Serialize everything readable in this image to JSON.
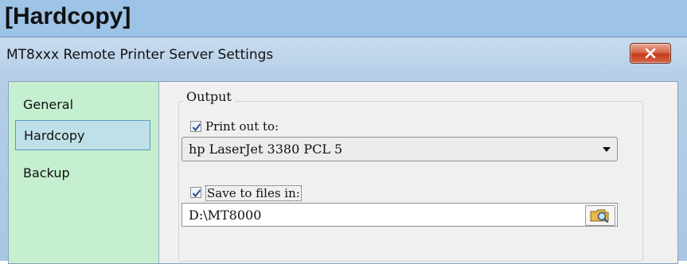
{
  "banner": {
    "title": "[Hardcopy]"
  },
  "window": {
    "title": "MT8xxx Remote Printer Server Settings"
  },
  "sidebar": {
    "items": [
      {
        "label": "General",
        "selected": false
      },
      {
        "label": "Hardcopy",
        "selected": true
      },
      {
        "label": "Backup",
        "selected": false
      }
    ]
  },
  "output": {
    "group_label": "Output",
    "print_out": {
      "label": "Print out to:",
      "checked": true
    },
    "printer_select": {
      "value": "hp LaserJet 3380 PCL 5"
    },
    "save_files": {
      "label": "Save to files in:",
      "checked": true
    },
    "path_input": {
      "value": "D:\\MT8000"
    }
  },
  "icons": {
    "close": "close-icon",
    "dropdown": "chevron-down-icon",
    "browse": "folder-browse-icon",
    "check": "checkmark-icon"
  },
  "colors": {
    "banner": "#9dc3e6",
    "sidebar": "#c6efcf",
    "selected_item": "#bfe0e8",
    "close_button": "#c4391a"
  }
}
